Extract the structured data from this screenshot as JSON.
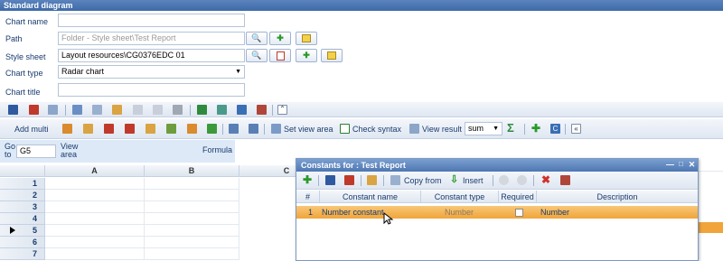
{
  "window": {
    "title": "Standard diagram"
  },
  "form": {
    "chart_name": {
      "label": "Chart name",
      "value": ""
    },
    "path": {
      "label": "Path",
      "placeholder": "Folder - Style sheet\\Test Report"
    },
    "style_sheet": {
      "label": "Style sheet",
      "value": "Layout resources\\CG0376EDC 01"
    },
    "chart_type": {
      "label": "Chart type",
      "value": "Radar chart"
    },
    "chart_title": {
      "label": "Chart title",
      "value": ""
    }
  },
  "toolbar2": {
    "add_multi": "Add multi",
    "set_view_area": "Set view area",
    "check_syntax": "Check syntax",
    "view_result": "View result",
    "aggregate": "sum"
  },
  "formula_bar": {
    "goto_label": "Go to",
    "goto_value": "G5",
    "view_area_label": "View area",
    "formula_label": "Formula"
  },
  "grid": {
    "columns": [
      "A",
      "B",
      "C"
    ],
    "rows": [
      "1",
      "2",
      "3",
      "4",
      "5",
      "6",
      "7"
    ],
    "active_row": "5"
  },
  "dialog": {
    "title": "Constants for : Test Report",
    "toolbar": {
      "from_label": "Copy from",
      "insert_label": "Insert"
    },
    "columns": [
      "#",
      "Constant name",
      "Constant type",
      "Required",
      "Description"
    ],
    "rows": [
      {
        "num": "1",
        "name": "Number constant",
        "type": "Number",
        "required": false,
        "description": "Number"
      }
    ]
  },
  "colors": {
    "title_bar": "#3d6aa8",
    "selected_row": "#f0a43a",
    "label_text": "#1a3c6e"
  }
}
